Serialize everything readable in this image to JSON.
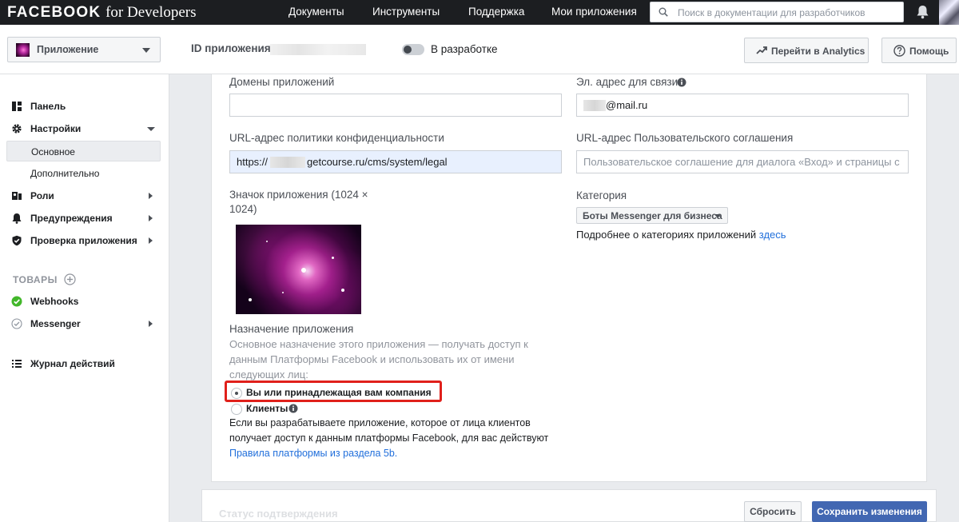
{
  "topnav": {
    "brand_main": "FACEBOOK",
    "brand_suffix": "for Developers",
    "links": [
      "Документы",
      "Инструменты",
      "Поддержка",
      "Мои приложения"
    ],
    "search_placeholder": "Поиск в документации для разработчиков"
  },
  "subbar": {
    "app_selector_label": "Приложение",
    "app_id_label": "ID приложения:",
    "dev_mode_label": "В разработке",
    "analytics_button": "Перейти в Analytics",
    "help_button": "Помощь"
  },
  "sidebar": {
    "items": [
      {
        "label": "Панель",
        "icon": "dashboard-icon"
      },
      {
        "label": "Настройки",
        "icon": "gear-icon"
      },
      {
        "label": "Основное",
        "active": true
      },
      {
        "label": "Дополнительно"
      },
      {
        "label": "Роли",
        "icon": "roles-icon"
      },
      {
        "label": "Предупреждения",
        "icon": "bell-icon"
      },
      {
        "label": "Проверка приложения",
        "icon": "shield-icon"
      }
    ],
    "products_heading": "ТОВАРЫ",
    "products": [
      {
        "label": "Webhooks",
        "icon": "check-circle-icon"
      },
      {
        "label": "Messenger",
        "icon": "check-outline-icon"
      }
    ],
    "activity_log": "Журнал действий"
  },
  "form": {
    "app_domains_label": "Домены приложений",
    "app_domains_value": "",
    "contact_email_label": "Эл. адрес для связи",
    "contact_email_value": "@mail.ru",
    "privacy_url_label": "URL-адрес политики конфиденциальности",
    "privacy_url_prefix": "https://",
    "privacy_url_value": "getcourse.ru/cms/system/legal",
    "terms_url_label": "URL-адрес Пользовательского соглашения",
    "terms_url_placeholder": "Пользовательское соглашение для диалога «Вход» и страницы с",
    "app_icon_label_1": "Значок приложения (1024 ×",
    "app_icon_label_2": "1024)",
    "category_label": "Категория",
    "category_value": "Боты Messenger для бизнеса",
    "category_more": "Подробнее о категориях приложений",
    "category_more_link": "здесь",
    "purpose_label": "Назначение приложения",
    "purpose_desc_1": "Основное назначение этого приложения — получать доступ к",
    "purpose_desc_2": "данным Платформы Facebook и использовать их от имени",
    "purpose_desc_3": "следующих лиц:",
    "radio_self": "Вы или принадлежащая вам компания",
    "radio_self_selected": true,
    "radio_clients": "Клиенты",
    "clients_note_1": "Если вы разрабатываете приложение, которое от лица клиентов",
    "clients_note_2": "получает доступ к данным платформы Facebook, для вас действуют",
    "clients_note_link": "Правила платформы из раздела 5b."
  },
  "bottom": {
    "status_label": "Статус подтверждения",
    "reset_button": "Сбросить",
    "save_button": "Сохранить изменения"
  },
  "colors": {
    "nav_bg": "#1c1e21",
    "primary": "#4267b2",
    "link": "#216fdb",
    "highlight": "#e0201b",
    "success": "#42b72a"
  }
}
